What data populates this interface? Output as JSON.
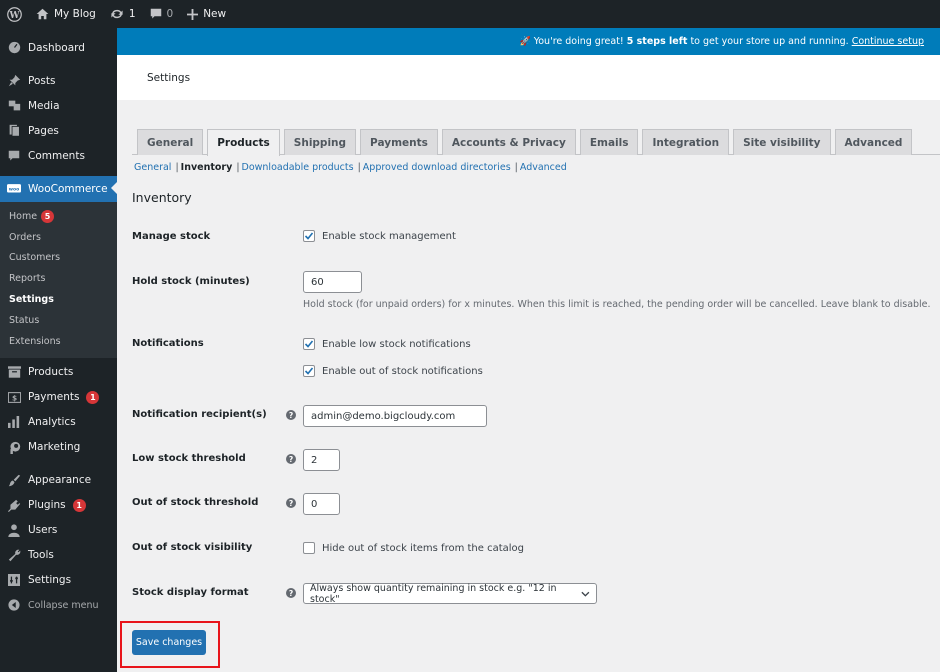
{
  "admin_bar": {
    "site_name": "My Blog",
    "updates_count": "1",
    "comments_count": "0",
    "new_label": "New"
  },
  "sidebar": {
    "items_top": [
      {
        "label": "Dashboard",
        "icon": "dashboard-icon"
      },
      {
        "label": "Posts",
        "icon": "pin-icon"
      },
      {
        "label": "Media",
        "icon": "media-icon"
      },
      {
        "label": "Pages",
        "icon": "pages-icon"
      },
      {
        "label": "Comments",
        "icon": "comment-icon"
      }
    ],
    "woocommerce": {
      "label": "WooCommerce",
      "icon": "woo-icon"
    },
    "woo_submenu": [
      {
        "label": "Home",
        "badge": "5"
      },
      {
        "label": "Orders"
      },
      {
        "label": "Customers"
      },
      {
        "label": "Reports"
      },
      {
        "label": "Settings",
        "current": true
      },
      {
        "label": "Status"
      },
      {
        "label": "Extensions"
      }
    ],
    "items_bottom": [
      {
        "label": "Products",
        "icon": "archive-icon"
      },
      {
        "label": "Payments",
        "icon": "dollar-icon",
        "badge": "1"
      },
      {
        "label": "Analytics",
        "icon": "chart-bar-icon"
      },
      {
        "label": "Marketing",
        "icon": "megaphone-icon"
      },
      {
        "label": "Appearance",
        "icon": "paintbrush-icon"
      },
      {
        "label": "Plugins",
        "icon": "plug-icon",
        "badge": "1"
      },
      {
        "label": "Users",
        "icon": "user-icon"
      },
      {
        "label": "Tools",
        "icon": "wrench-icon"
      },
      {
        "label": "Settings",
        "icon": "sliders-icon"
      },
      {
        "label": "Collapse menu",
        "icon": "collapse-icon"
      }
    ]
  },
  "notice": {
    "emoji": "🚀",
    "prefix": "You're doing great!",
    "bold": "5 steps left",
    "suffix": "to get your store up and running.",
    "link": "Continue setup"
  },
  "header": {
    "title": "Settings"
  },
  "tabs": [
    {
      "label": "General"
    },
    {
      "label": "Products",
      "active": true
    },
    {
      "label": "Shipping"
    },
    {
      "label": "Payments"
    },
    {
      "label": "Accounts & Privacy"
    },
    {
      "label": "Emails"
    },
    {
      "label": "Integration"
    },
    {
      "label": "Site visibility"
    },
    {
      "label": "Advanced"
    }
  ],
  "subsections": [
    {
      "label": "General"
    },
    {
      "label": "Inventory",
      "current": true
    },
    {
      "label": "Downloadable products"
    },
    {
      "label": "Approved download directories"
    },
    {
      "label": "Advanced"
    }
  ],
  "section_title": "Inventory",
  "fields": {
    "manage_stock": {
      "label": "Manage stock",
      "checkbox_label": "Enable stock management",
      "checked": true
    },
    "hold_stock": {
      "label": "Hold stock (minutes)",
      "value": "60",
      "description": "Hold stock (for unpaid orders) for x minutes. When this limit is reached, the pending order will be cancelled. Leave blank to disable."
    },
    "notifications": {
      "label": "Notifications",
      "low_label": "Enable low stock notifications",
      "low_checked": true,
      "out_label": "Enable out of stock notifications",
      "out_checked": true
    },
    "recipient": {
      "label": "Notification recipient(s)",
      "value": "admin@demo.bigcloudy.com"
    },
    "low_threshold": {
      "label": "Low stock threshold",
      "value": "2"
    },
    "out_threshold": {
      "label": "Out of stock threshold",
      "value": "0"
    },
    "visibility": {
      "label": "Out of stock visibility",
      "checkbox_label": "Hide out of stock items from the catalog",
      "checked": false
    },
    "display_format": {
      "label": "Stock display format",
      "value": "Always show quantity remaining in stock e.g. \"12 in stock\""
    }
  },
  "save_label": "Save changes",
  "colors": {
    "accent": "#2271b1",
    "notice": "#007cba",
    "sidebar": "#1d2327",
    "badge": "#d63638",
    "highlight": "#e8141b"
  }
}
